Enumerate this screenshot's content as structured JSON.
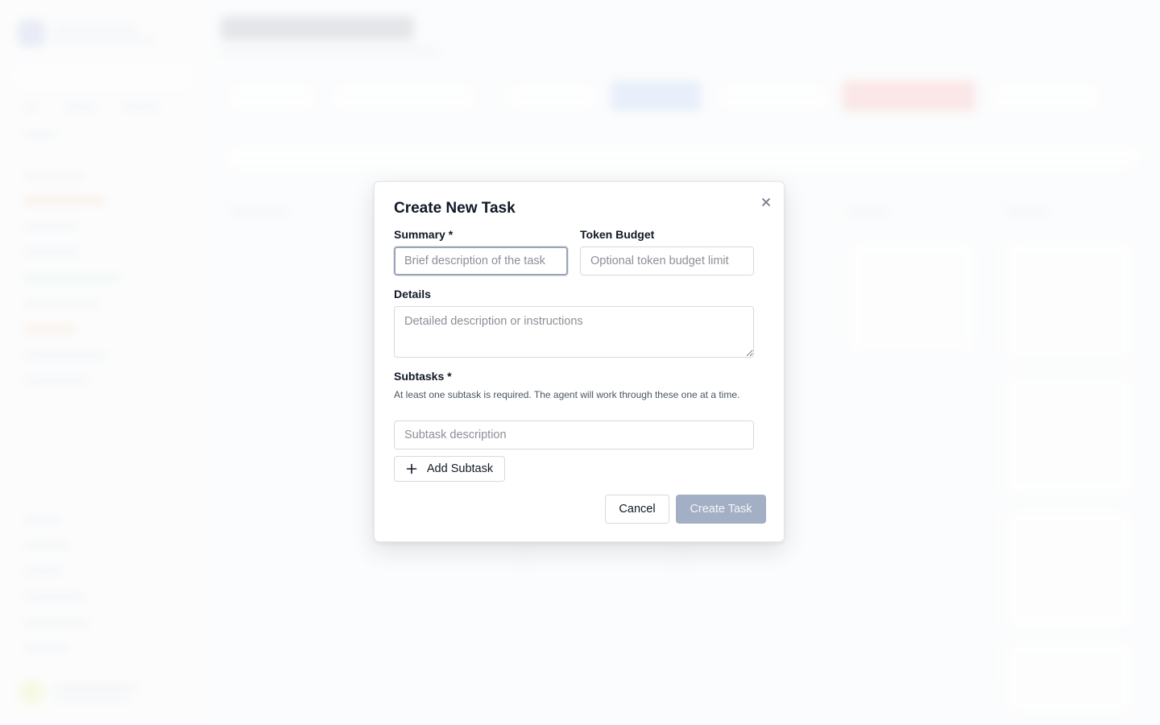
{
  "modal": {
    "title": "Create New Task",
    "close_icon": "close-icon",
    "fields": {
      "summary": {
        "label": "Summary *",
        "placeholder": "Brief description of the task",
        "value": ""
      },
      "token_budget": {
        "label": "Token Budget",
        "placeholder": "Optional token budget limit",
        "value": ""
      },
      "details": {
        "label": "Details",
        "placeholder": "Detailed description or instructions",
        "value": ""
      },
      "subtasks": {
        "label": "Subtasks *",
        "help": "At least one subtask is required. The agent will work through these one at a time.",
        "items": [
          {
            "placeholder": "Subtask description",
            "value": ""
          }
        ]
      }
    },
    "add_subtask": {
      "icon": "plus-icon",
      "label": "Add Subtask"
    },
    "actions": {
      "cancel_label": "Cancel",
      "create_label": "Create Task"
    }
  },
  "colors": {
    "text": "#111827",
    "border": "#d6d9df",
    "focus_border": "#9aa4b6",
    "primary_disabled": "#a3afc4"
  }
}
